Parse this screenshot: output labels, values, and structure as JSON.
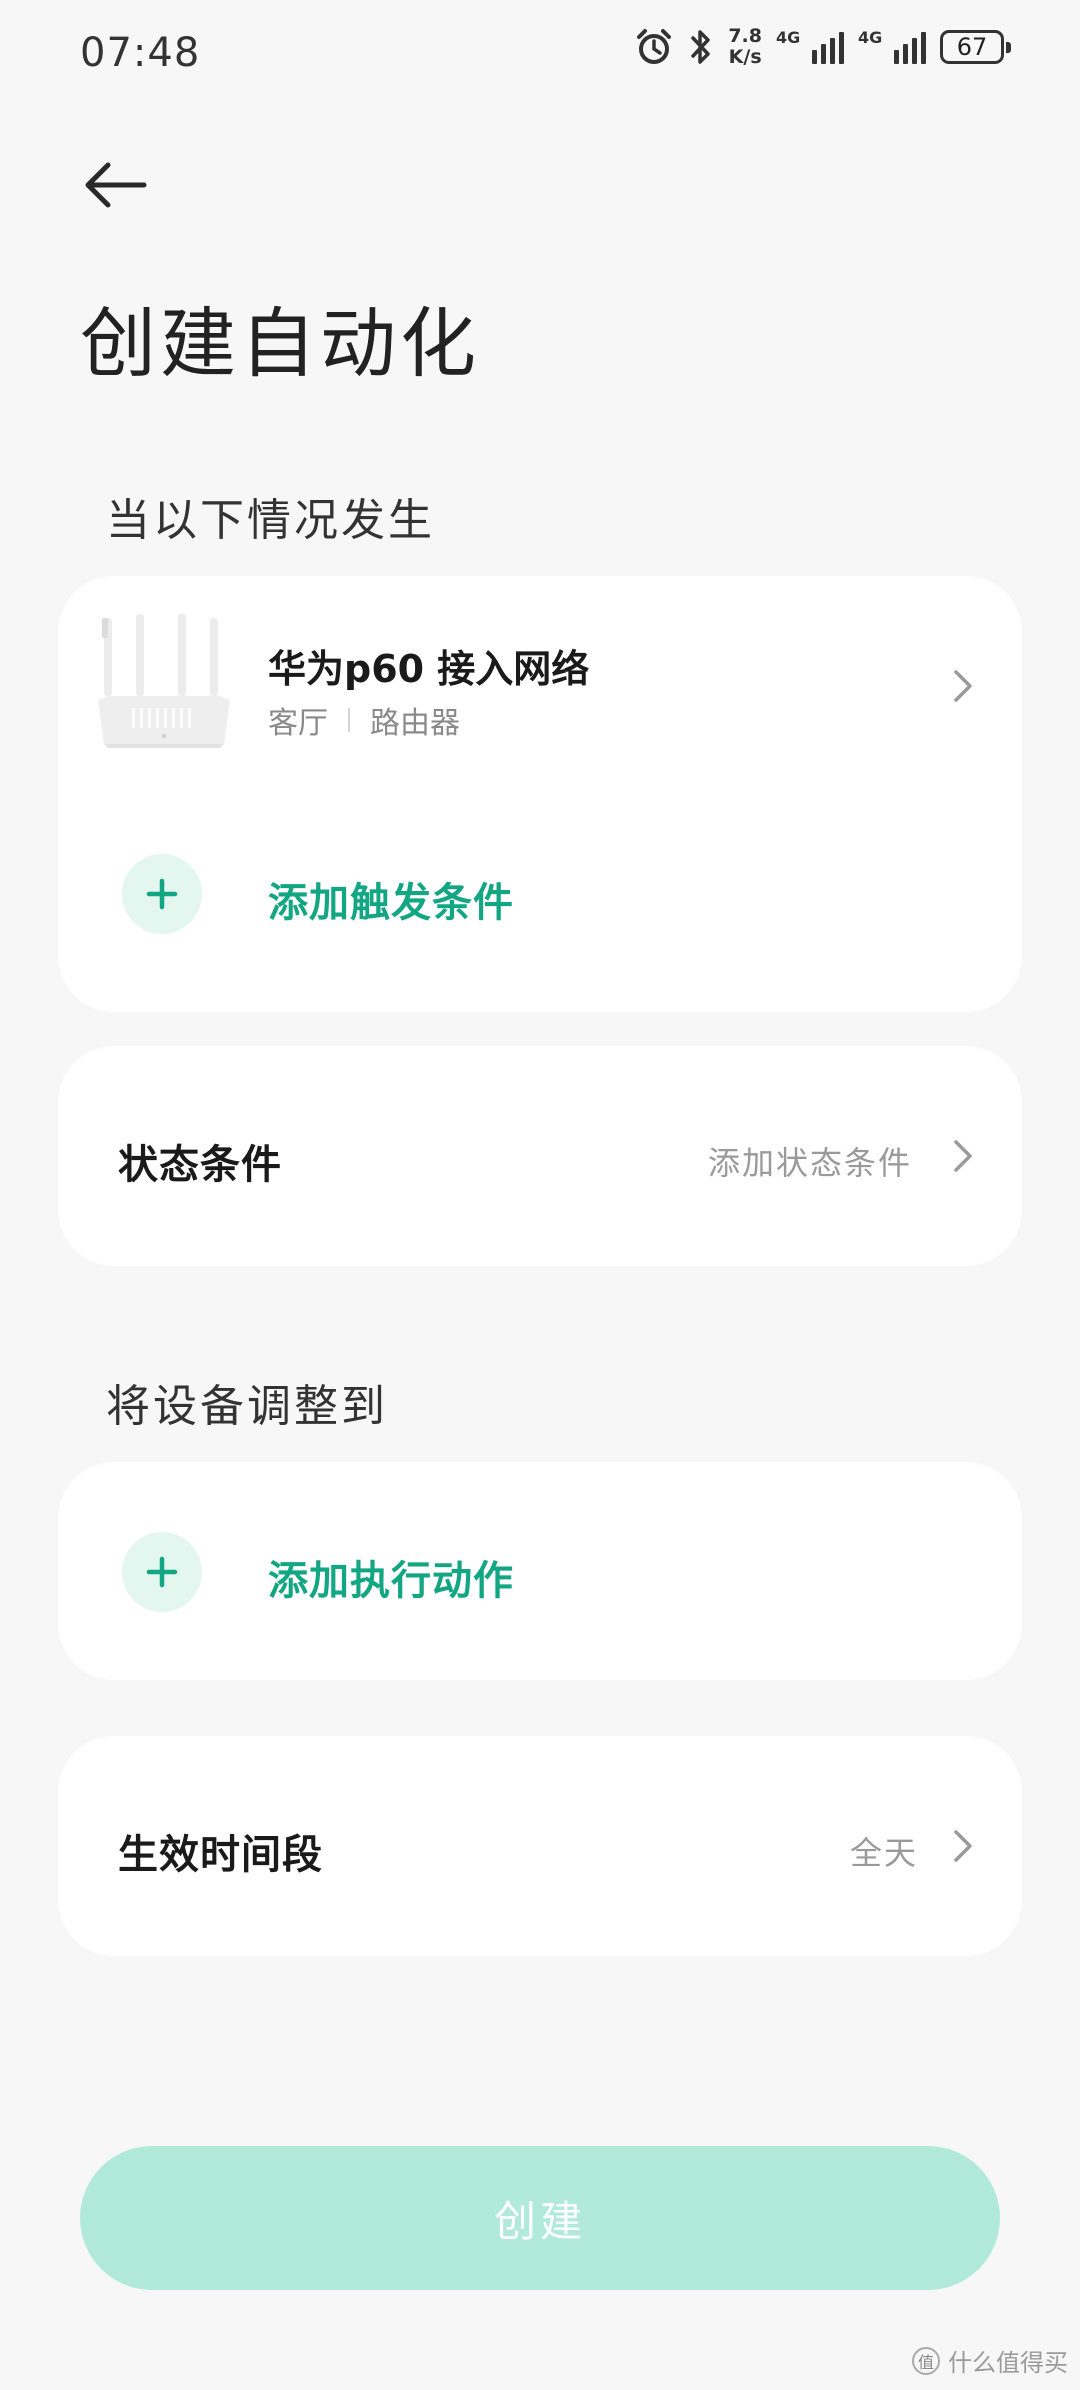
{
  "status_bar": {
    "time": "07:48",
    "net_speed_value": "7.8",
    "net_speed_unit": "K/s",
    "sim1_label": "4G",
    "sim2_label": "4G",
    "battery_level": "67",
    "icons": [
      "alarm-icon",
      "bluetooth-icon",
      "signal-icon",
      "battery-icon"
    ]
  },
  "header": {
    "title": "创建自动化"
  },
  "trigger_section": {
    "title": "当以下情况发生",
    "device": {
      "name": "华为p60 接入网络",
      "room": "客厅",
      "type": "路由器",
      "icon": "router-icon"
    },
    "add_label": "添加触发条件"
  },
  "state_condition": {
    "label": "状态条件",
    "value": "添加状态条件"
  },
  "action_section": {
    "title": "将设备调整到",
    "add_label": "添加执行动作"
  },
  "effective_period": {
    "label": "生效时间段",
    "value": "全天"
  },
  "create_button": {
    "label": "创建"
  },
  "watermark": {
    "badge": "值",
    "text": "什么值得买"
  },
  "colors": {
    "accent": "#13a683",
    "accent_light": "#e3f6f0",
    "button_disabled": "#b1eadb",
    "background": "#f7f7f7",
    "card": "#ffffff"
  }
}
